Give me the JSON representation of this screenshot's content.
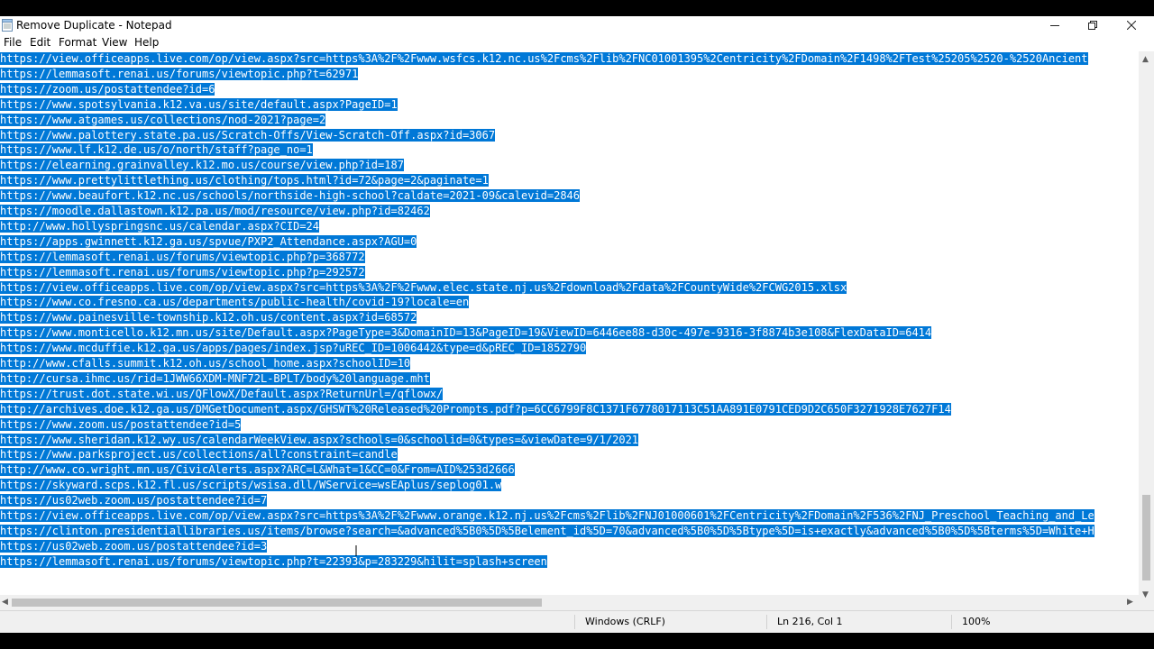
{
  "window": {
    "title": "Remove Duplicate - Notepad",
    "controls": {
      "minimize_icon": "minimize-icon",
      "restore_icon": "restore-icon",
      "close_icon": "close-icon"
    }
  },
  "menu": [
    "File",
    "Edit",
    "Format",
    "View",
    "Help"
  ],
  "editor": {
    "selection_color": "#0078d7",
    "lines": [
      "https://view.officeapps.live.com/op/view.aspx?src=https%3A%2F%2Fwww.wsfcs.k12.nc.us%2Fcms%2Flib%2FNC01001395%2Centricity%2FDomain%2F1498%2FTest%25205%2520-%2520Ancient",
      "https://lemmasoft.renai.us/forums/viewtopic.php?t=62971",
      "https://zoom.us/postattendee?id=6",
      "https://www.spotsylvania.k12.va.us/site/default.aspx?PageID=1",
      "https://www.atgames.us/collections/nod-2021?page=2",
      "https://www.palottery.state.pa.us/Scratch-Offs/View-Scratch-Off.aspx?id=3067",
      "https://www.lf.k12.de.us/o/north/staff?page_no=1",
      "https://elearning.grainvalley.k12.mo.us/course/view.php?id=187",
      "https://www.prettylittlething.us/clothing/tops.html?id=72&page=2&paginate=1",
      "https://www.beaufort.k12.nc.us/schools/northside-high-school?caldate=2021-09&calevid=2846",
      "https://moodle.dallastown.k12.pa.us/mod/resource/view.php?id=82462",
      "http://www.hollyspringsnc.us/calendar.aspx?CID=24",
      "https://apps.gwinnett.k12.ga.us/spvue/PXP2_Attendance.aspx?AGU=0",
      "https://lemmasoft.renai.us/forums/viewtopic.php?p=368772",
      "https://lemmasoft.renai.us/forums/viewtopic.php?p=292572",
      "https://view.officeapps.live.com/op/view.aspx?src=https%3A%2F%2Fwww.elec.state.nj.us%2Fdownload%2Fdata%2FCountyWide%2FCWG2015.xlsx",
      "https://www.co.fresno.ca.us/departments/public-health/covid-19?locale=en",
      "https://www.painesville-township.k12.oh.us/content.aspx?id=68572",
      "https://www.monticello.k12.mn.us/site/Default.aspx?PageType=3&DomainID=13&PageID=19&ViewID=6446ee88-d30c-497e-9316-3f8874b3e108&FlexDataID=6414",
      "https://www.mcduffie.k12.ga.us/apps/pages/index.jsp?uREC_ID=1006442&type=d&pREC_ID=1852790",
      "http://www.cfalls.summit.k12.oh.us/school_home.aspx?schoolID=10",
      "http://cursa.ihmc.us/rid=1JWW66XDM-MNF72L-BPLT/body%20language.mht",
      "https://trust.dot.state.wi.us/QFlowX/Default.aspx?ReturnUrl=/qflowx/",
      "http://archives.doe.k12.ga.us/DMGetDocument.aspx/GHSWT%20Released%20Prompts.pdf?p=6CC6799F8C1371F6778017113C51AA891E0791CED9D2C650F3271928E7627F14",
      "https://www.zoom.us/postattendee?id=5",
      "https://www.sheridan.k12.wy.us/calendarWeekView.aspx?schools=0&schoolid=0&types=&viewDate=9/1/2021",
      "https://www.parksproject.us/collections/all?constraint=candle",
      "http://www.co.wright.mn.us/CivicAlerts.aspx?ARC=L&What=1&CC=0&From=AID%253d2666",
      "https://skyward.scps.k12.fl.us/scripts/wsisa.dll/WService=wsEAplus/seplog01.w",
      "https://us02web.zoom.us/postattendee?id=7",
      "https://view.officeapps.live.com/op/view.aspx?src=https%3A%2F%2Fwww.orange.k12.nj.us%2Fcms%2Flib%2FNJ01000601%2FCentricity%2FDomain%2F536%2FNJ_Preschool_Teaching_and_Le",
      "https://clinton.presidentiallibraries.us/items/browse?search=&advanced%5B0%5D%5Belement_id%5D=70&advanced%5B0%5D%5Btype%5D=is+exactly&advanced%5B0%5D%5Bterms%5D=White+H",
      "https://us02web.zoom.us/postattendee?id=3",
      "https://lemmasoft.renai.us/forums/viewtopic.php?t=22393&p=283229&hilit=splash+screen"
    ]
  },
  "status": {
    "line_ending": "Windows (CRLF)",
    "position": "Ln 216, Col 1",
    "zoom": "100%"
  }
}
